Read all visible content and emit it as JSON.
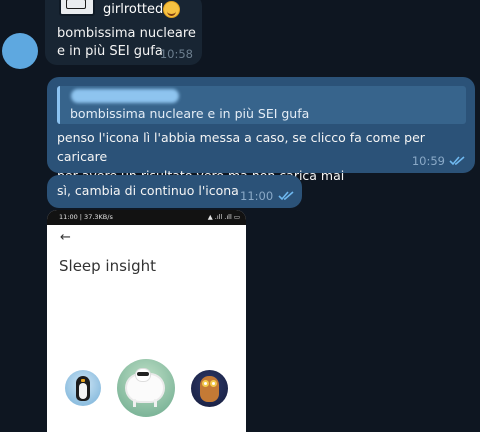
{
  "contact": {
    "avatar_color": "#5ea8e0"
  },
  "messages": {
    "incoming": {
      "reply_author": "girlrotted",
      "reply_emoji": "smiling-face-with-hearts",
      "text_line1": "bombissima nucleare",
      "text_line2": "e in più SEI gufa",
      "time": "10:58"
    },
    "outgoing_1": {
      "quote_text": "bombissima nucleare e in più SEI gufa",
      "text_line1": "penso l'icona lì l'abbia messa a caso, se clicco fa come per caricare",
      "text_line2": "per avere un risultato vero ma non carica mai",
      "time": "10:59",
      "status": "read"
    },
    "outgoing_2": {
      "text": "sì, cambia di continuo l'icona",
      "time": "11:00",
      "status": "read"
    }
  },
  "screenshot": {
    "status_left": "11:00 | 37.3KB/s",
    "status_right": "▲ .ıll .ıll ▭",
    "back_icon": "←",
    "title": "Sleep insight",
    "animals": [
      "penguin",
      "sheep",
      "owl"
    ]
  },
  "colors": {
    "background": "#0e1621",
    "incoming_bubble": "#182533",
    "outgoing_bubble": "#2b5278",
    "quote_bar": "#8cc2f0"
  }
}
